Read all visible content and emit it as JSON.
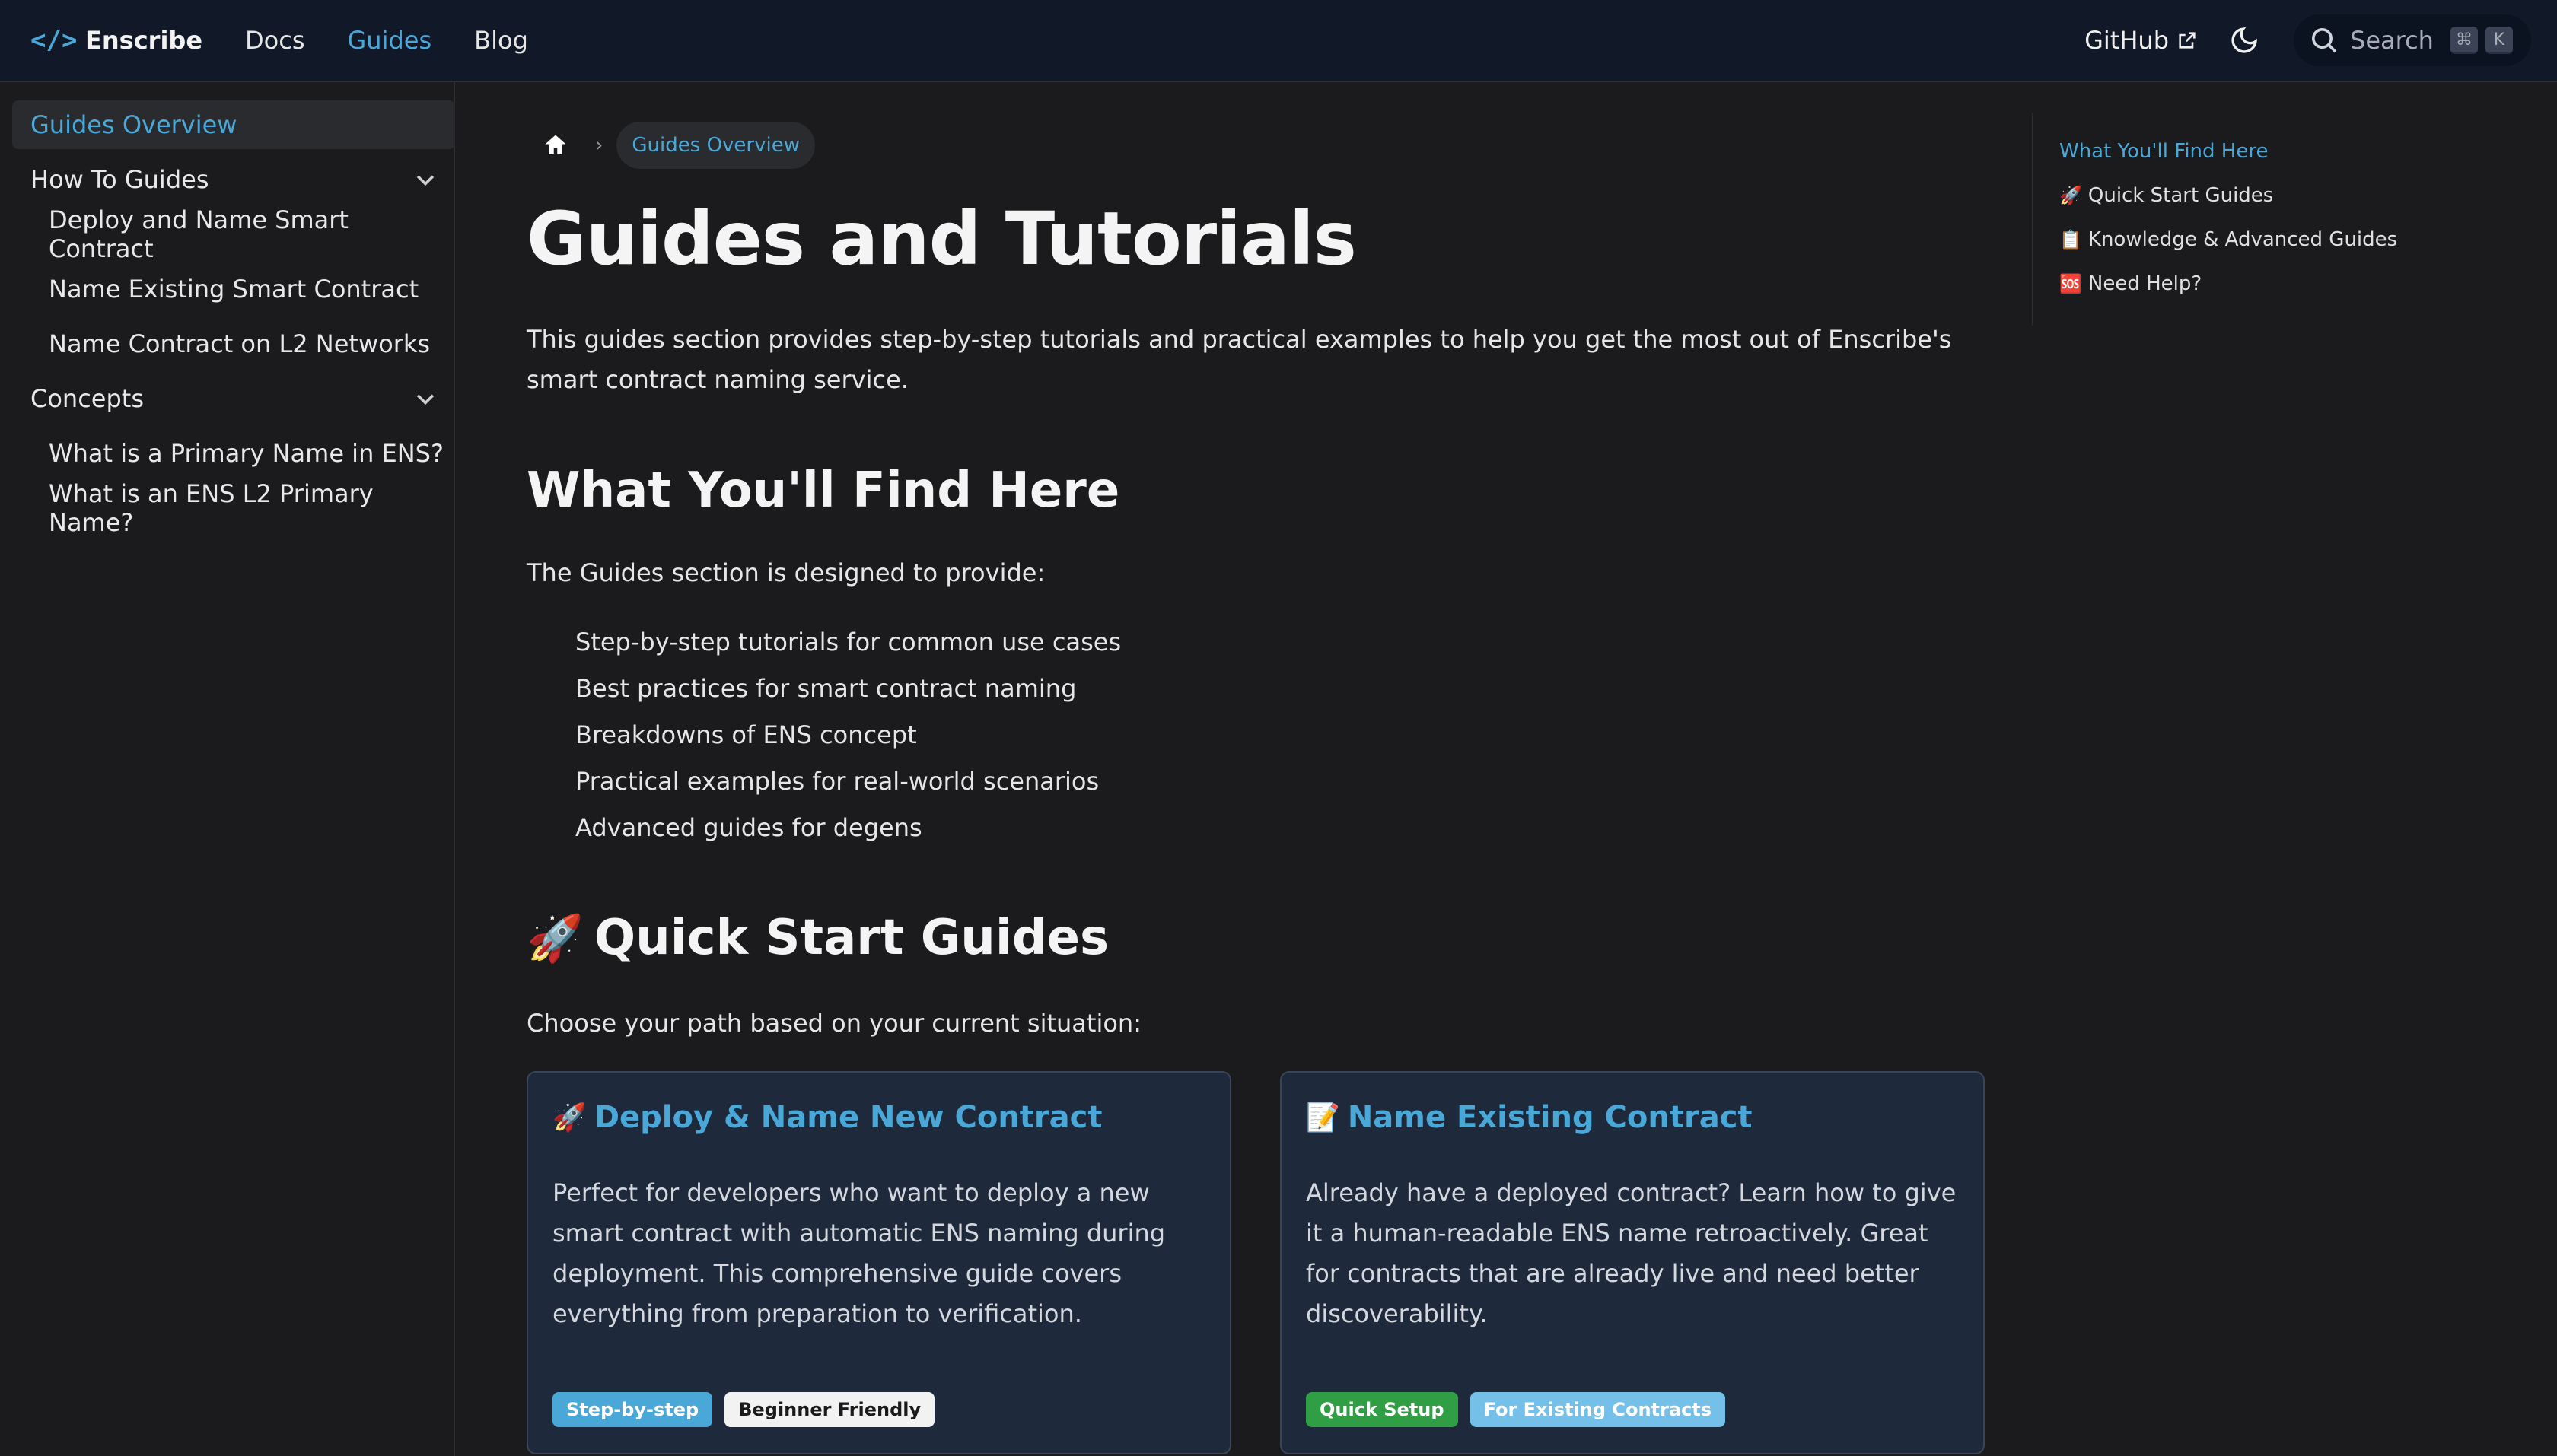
{
  "navbar": {
    "brand_icon": "</>",
    "brand_title": "Enscribe",
    "links": [
      "Docs",
      "Guides",
      "Blog"
    ],
    "github_label": "GitHub",
    "search_placeholder": "Search",
    "search_keys": [
      "⌘",
      "K"
    ],
    "accent_color": "#4aa8d8"
  },
  "sidebar": {
    "items": [
      {
        "label": "Guides Overview",
        "type": "active"
      },
      {
        "label": "How To Guides",
        "type": "category"
      },
      {
        "label": "Deploy and Name Smart Contract",
        "type": "sub"
      },
      {
        "label": "Name Existing Smart Contract",
        "type": "sub"
      },
      {
        "label": "Name Contract on L2 Networks",
        "type": "sub"
      },
      {
        "label": "Concepts",
        "type": "category"
      },
      {
        "label": "What is a Primary Name in ENS?",
        "type": "sub"
      },
      {
        "label": "What is an ENS L2 Primary Name?",
        "type": "sub"
      }
    ]
  },
  "breadcrumb": {
    "current": "Guides Overview",
    "separator": "›"
  },
  "main": {
    "title": "Guides and Tutorials",
    "intro": "This guides section provides step-by-step tutorials and practical examples to help you get the most out of Enscribe's smart contract naming service.",
    "find_heading": "What You'll Find Here",
    "designed_text": "The Guides section is designed to provide:",
    "features": [
      "Step-by-step tutorials for common use cases",
      "Best practices for smart contract naming",
      "Breakdowns of ENS concept",
      "Practical examples for real-world scenarios",
      "Advanced guides for degens"
    ],
    "quick_emoji": "🚀",
    "quick_heading": "Quick Start Guides",
    "choose_text": "Choose your path based on your current situation:",
    "cards": [
      {
        "emoji": "🚀",
        "title": "Deploy & Name New Contract",
        "description": "Perfect for developers who want to deploy a new smart contract with automatic ENS naming during deployment. This comprehensive guide covers everything from preparation to verification.",
        "tags": [
          {
            "label": "Step-by-step",
            "bg": "#4aa8d8",
            "fg": "#ffffff"
          },
          {
            "label": "Beginner Friendly",
            "bg": "#f2f2f2",
            "fg": "#1b1b1d"
          }
        ]
      },
      {
        "emoji": "📝",
        "title": "Name Existing Contract",
        "description": "Already have a deployed contract? Learn how to give it a human-readable ENS name retroactively. Great for contracts that are already live and need better discoverability.",
        "tags": [
          {
            "label": "Quick Setup",
            "bg": "#2f9e44",
            "fg": "#ffffff"
          },
          {
            "label": "For Existing Contracts",
            "bg": "#74c0e8",
            "fg": "#ffffff"
          }
        ]
      }
    ]
  },
  "toc": {
    "items": [
      {
        "emoji": "",
        "label": "What You'll Find Here"
      },
      {
        "emoji": "🚀",
        "label": "Quick Start Guides"
      },
      {
        "emoji": "📋",
        "label": "Knowledge & Advanced Guides"
      },
      {
        "emoji": "🆘",
        "label": "Need Help?"
      }
    ]
  }
}
